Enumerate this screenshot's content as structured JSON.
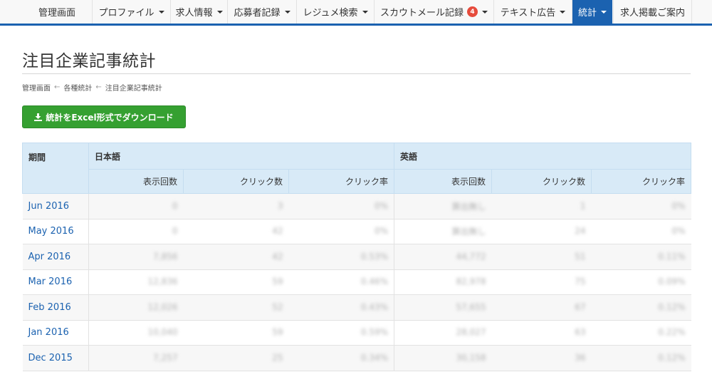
{
  "nav": {
    "items": [
      {
        "label": "管理画面",
        "caret": false
      },
      {
        "label": "プロファイル",
        "caret": true
      },
      {
        "label": "求人情報",
        "caret": true
      },
      {
        "label": "応募者記録",
        "caret": true
      },
      {
        "label": "レジュメ検索",
        "caret": true
      },
      {
        "label": "スカウトメール記録",
        "caret": true,
        "badge": "4"
      },
      {
        "label": "テキスト広告",
        "caret": true
      },
      {
        "label": "統計",
        "caret": true,
        "active": true
      }
    ],
    "right_link": "求人掲載ご案内"
  },
  "page_title": "注目企業記事統計",
  "breadcrumb": {
    "separator": "←",
    "items": [
      "管理画面",
      "各種統計",
      "注目企業記事統計"
    ]
  },
  "download_button": {
    "label": "統計をExcel形式でダウンロード",
    "icon": "download-icon"
  },
  "table": {
    "period_header": "期間",
    "groups": [
      "日本語",
      "英語"
    ],
    "sub_headers": [
      "表示回数",
      "クリック数",
      "クリック率"
    ],
    "rows": [
      {
        "period": "Jun 2016",
        "ja": [
          "0",
          "3",
          "0%"
        ],
        "en": [
          "算出無し",
          "1",
          "0%"
        ]
      },
      {
        "period": "May 2016",
        "ja": [
          "0",
          "42",
          "0%"
        ],
        "en": [
          "算出無し",
          "24",
          "0%"
        ]
      },
      {
        "period": "Apr 2016",
        "ja": [
          "7,856",
          "42",
          "0.53%"
        ],
        "en": [
          "44,772",
          "51",
          "0.11%"
        ]
      },
      {
        "period": "Mar 2016",
        "ja": [
          "12,836",
          "59",
          "0.46%"
        ],
        "en": [
          "82,978",
          "75",
          "0.09%"
        ]
      },
      {
        "period": "Feb 2016",
        "ja": [
          "12,026",
          "52",
          "0.43%"
        ],
        "en": [
          "57,655",
          "67",
          "0.12%"
        ]
      },
      {
        "period": "Jan 2016",
        "ja": [
          "10,040",
          "59",
          "0.59%"
        ],
        "en": [
          "28,027",
          "63",
          "0.22%"
        ]
      },
      {
        "period": "Dec 2015",
        "ja": [
          "7,257",
          "25",
          "0.34%"
        ],
        "en": [
          "30,158",
          "36",
          "0.12%"
        ]
      }
    ]
  },
  "colors": {
    "nav_accent": "#1b62b0",
    "button_green": "#35a031",
    "header_blue": "#d8eaf7",
    "badge_red": "#e64b3c"
  }
}
